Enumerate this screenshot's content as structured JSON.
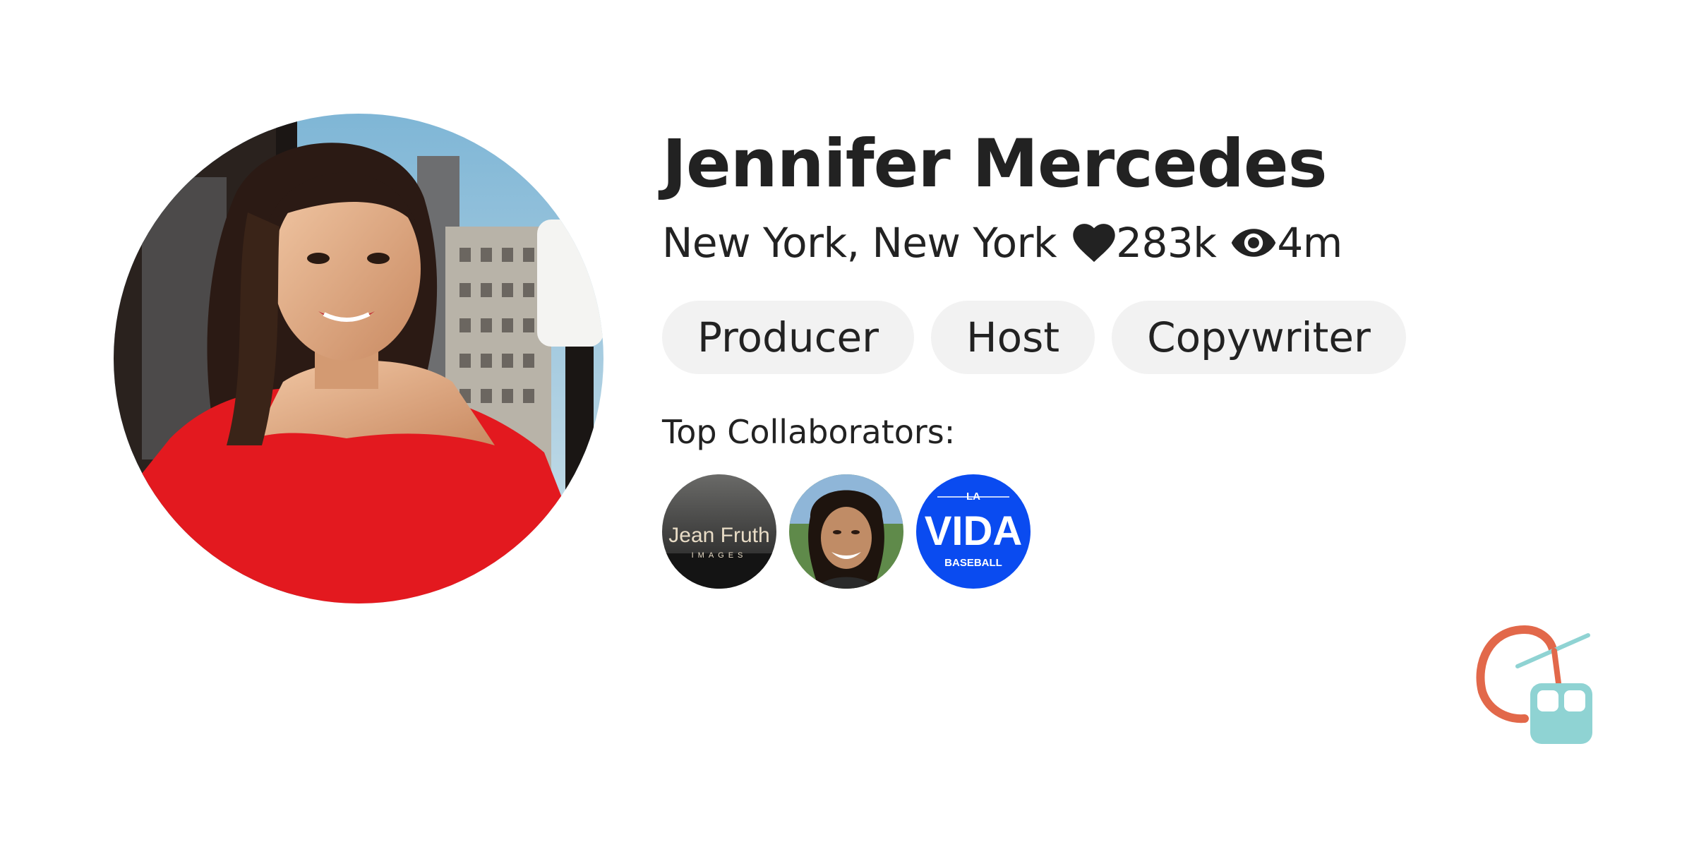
{
  "profile": {
    "name": "Jennifer Mercedes",
    "location": "New York, New York",
    "likes": "283k",
    "views": "4m",
    "like_icon": "heart-icon",
    "view_icon": "eye-icon",
    "avatar_description": "profile photo"
  },
  "roles": [
    {
      "label": "Producer"
    },
    {
      "label": "Host"
    },
    {
      "label": "Copywriter"
    }
  ],
  "collaborators": {
    "label": "Top Collaborators:",
    "items": [
      {
        "name": "Jean Fruth Images",
        "logo_text": "Jean Fruth",
        "logo_subtext": "IMAGES"
      },
      {
        "name": "collaborator-person"
      },
      {
        "name": "La Vida Baseball",
        "logo_top": "LA",
        "logo_main": "VIDA",
        "logo_sub": "BASEBALL"
      }
    ]
  },
  "colors": {
    "text": "#222222",
    "tag_bg": "#f2f2f2",
    "brand_orange": "#e2684a",
    "brand_teal": "#8fd3d3",
    "lavida_blue": "#0a4bf0"
  }
}
